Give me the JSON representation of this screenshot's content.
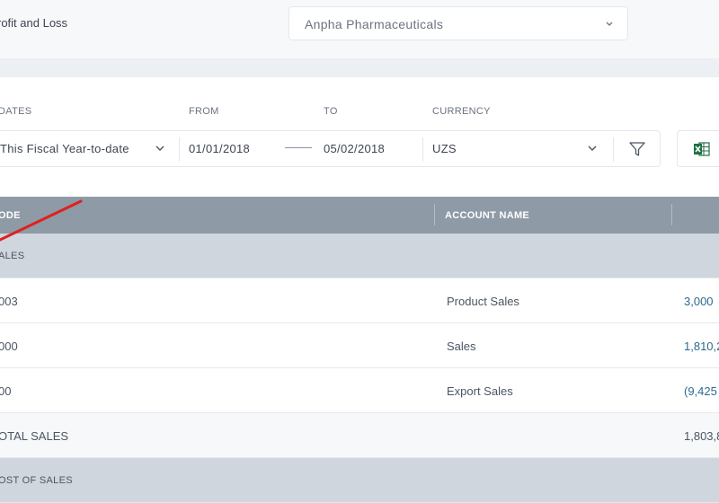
{
  "header": {
    "title": "rofit and Loss",
    "company": "Anpha Pharmaceuticals"
  },
  "filters": {
    "dates_label": "DATES",
    "dates_value": "This Fiscal Year-to-date",
    "from_label": "FROM",
    "from_value": "01/01/2018",
    "to_label": "TO",
    "to_value": "05/02/2018",
    "currency_label": "CURRENCY",
    "currency_value": "UZS"
  },
  "icons": {
    "filter": "funnel-icon",
    "export": "excel-icon",
    "chevron": "chevron-down-icon"
  },
  "colors": {
    "header_bg": "#8e9aa6",
    "section_bg": "#cfd6dd",
    "amount": "#2b6a8e",
    "excel": "#1d7044",
    "annotation": "#e02020"
  },
  "table": {
    "columns": [
      "ODE",
      "ACCOUNT NAME"
    ],
    "rows": [
      {
        "type": "section",
        "code": "ALES",
        "name": "",
        "amount": ""
      },
      {
        "type": "item",
        "code": "003",
        "name": "Product Sales",
        "amount": "3,000"
      },
      {
        "type": "item",
        "code": "000",
        "name": "Sales",
        "amount": "1,810,2"
      },
      {
        "type": "item",
        "code": "00",
        "name": "Export Sales",
        "amount": "(9,425"
      },
      {
        "type": "total",
        "code": "OTAL SALES",
        "name": "",
        "amount": "1,803,8"
      },
      {
        "type": "section",
        "code": "OST OF SALES",
        "name": "",
        "amount": ""
      }
    ]
  }
}
